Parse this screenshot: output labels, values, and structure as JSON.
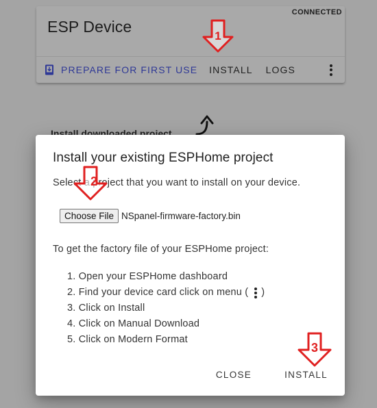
{
  "device_card": {
    "title": "ESP Device",
    "status": "CONNECTED",
    "actions": {
      "prepare_label": "PREPARE FOR FIRST USE",
      "install_label": "INSTALL",
      "logs_label": "LOGS"
    }
  },
  "background": {
    "text": "Install downloaded project"
  },
  "dialog": {
    "title": "Install your existing ESPHome project",
    "description": "Select a project that you want to install on your device.",
    "file_input": {
      "button_label": "Choose File",
      "file_name": "NSpanel-firmware-factory.bin"
    },
    "instructions_header": "To get the factory file of your ESPHome project:",
    "steps": [
      "1. Open your ESPHome dashboard",
      "2. Find your device card click on menu (",
      "3. Click on Install",
      "4. Click on Manual Download",
      "5. Click on Modern Format"
    ],
    "step2_suffix": ")",
    "close_label": "CLOSE",
    "install_label": "INSTALL"
  },
  "annotations": {
    "arrow1_label": "1",
    "arrow2_label": "2",
    "arrow3_label": "3",
    "color": "#e02020"
  },
  "icons": {
    "prepare": "phone-download-icon",
    "more": "kebab-menu-icon",
    "behind_arrow": "curved-up-arrow-icon"
  }
}
